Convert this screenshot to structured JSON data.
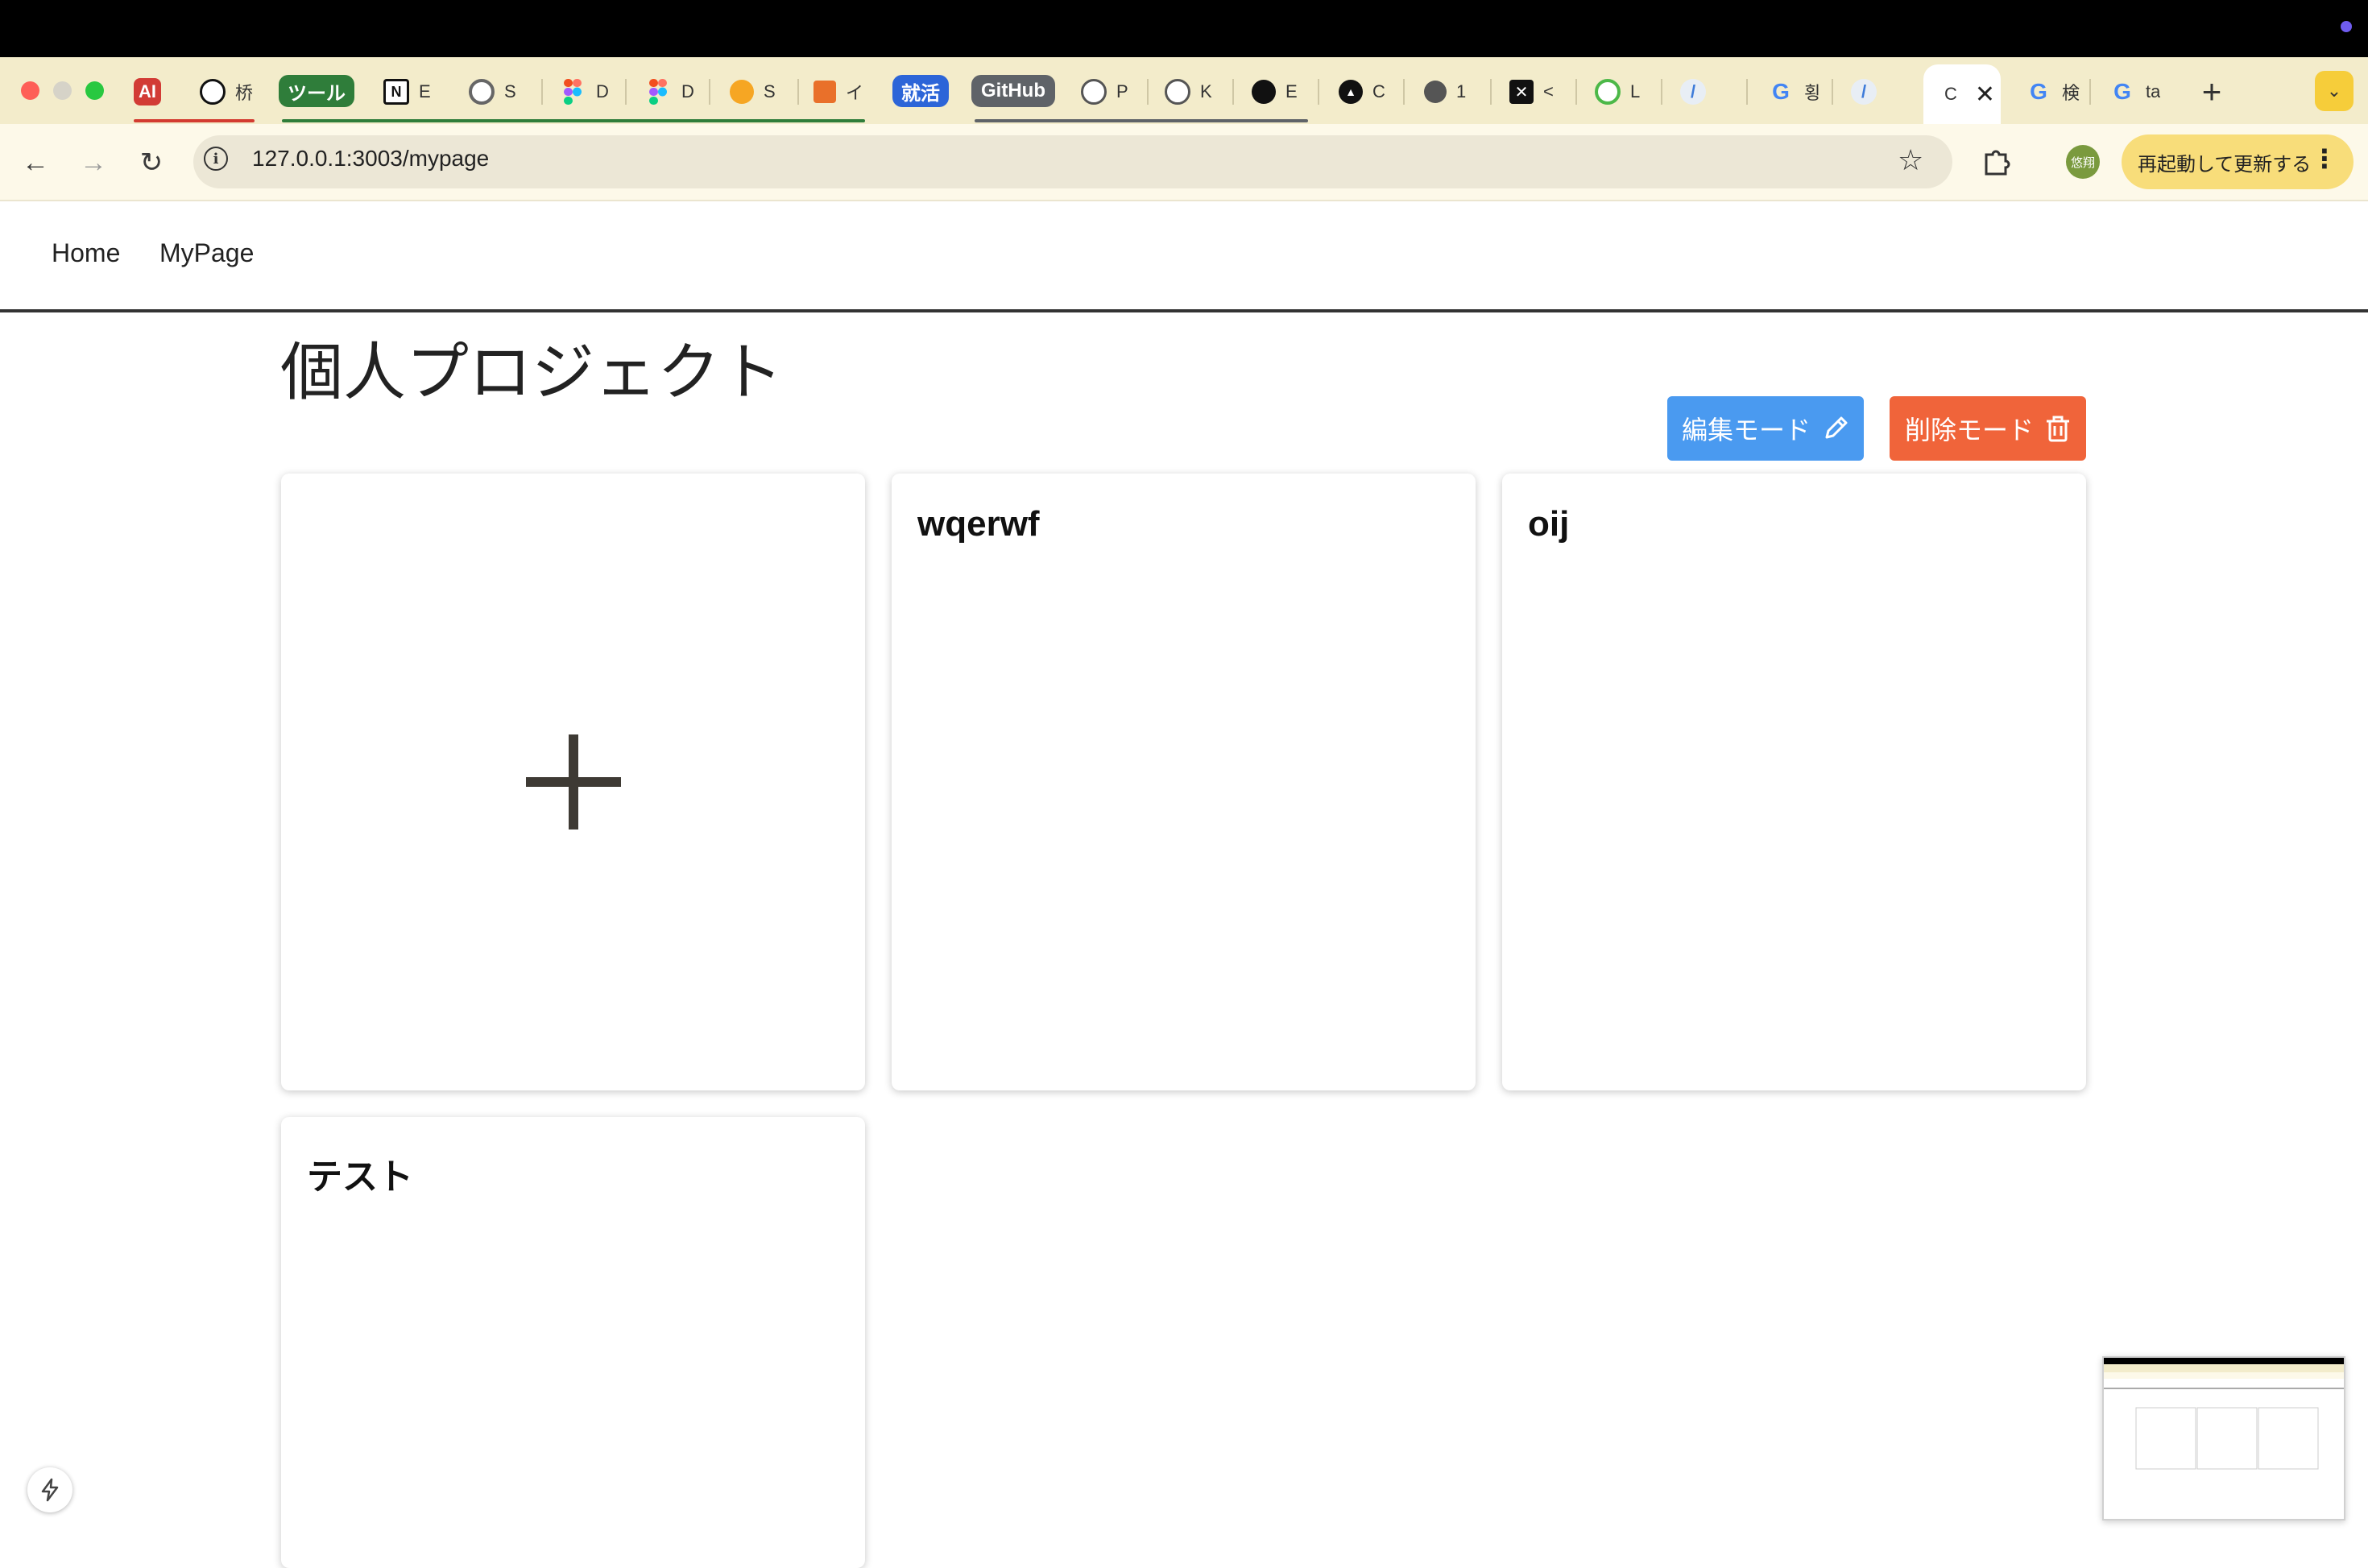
{
  "browser": {
    "tabs": [
      {
        "icon": "AI",
        "label": "",
        "color": "#d23b35"
      },
      {
        "icon": "openai-icon",
        "label": "桥"
      },
      {
        "group": "ツール",
        "color": "#2f7d3a"
      },
      {
        "icon": "notion-icon",
        "label": "E"
      },
      {
        "icon": "ring-icon",
        "label": "S"
      },
      {
        "icon": "figma-icon",
        "label": "D"
      },
      {
        "icon": "figma-icon",
        "label": "D"
      },
      {
        "icon": "drive-icon",
        "label": "S"
      },
      {
        "icon": "window-icon",
        "label": "イ"
      },
      {
        "group": "就活",
        "color": "#2c65d8"
      },
      {
        "group": "GitHub",
        "color": "#5f6368"
      },
      {
        "icon": "github-icon",
        "label": "P"
      },
      {
        "icon": "github-icon",
        "label": "K"
      },
      {
        "icon": "github-icon",
        "label": "E"
      },
      {
        "icon": "triangle-icon",
        "label": "C"
      },
      {
        "icon": "globe-icon",
        "label": "1"
      },
      {
        "icon": "crossed-icon",
        "label": "<"
      },
      {
        "icon": "leaf-icon",
        "label": "L"
      },
      {
        "icon": "slash-icon",
        "label": ""
      },
      {
        "icon": "google-icon",
        "label": "횡"
      },
      {
        "icon": "slash-icon",
        "label": ""
      },
      {
        "icon": "",
        "label": "C",
        "active": true
      },
      {
        "icon": "google-icon",
        "label": "検"
      },
      {
        "icon": "google-icon",
        "label": "ta"
      }
    ],
    "address": "127.0.0.1:3003/mypage",
    "profile_label": "悠翔",
    "update_label": "再起動して更新する"
  },
  "app": {
    "nav": {
      "home": "Home",
      "mypage": "MyPage"
    },
    "page_title": "個人プロジェクト",
    "edit_mode_label": "編集モード",
    "delete_mode_label": "削除モード",
    "edit_color": "#4a9af0",
    "delete_color": "#f0643a",
    "projects": [
      {
        "title": "wqerwf"
      },
      {
        "title": "oij"
      },
      {
        "title": "テスト"
      }
    ]
  }
}
